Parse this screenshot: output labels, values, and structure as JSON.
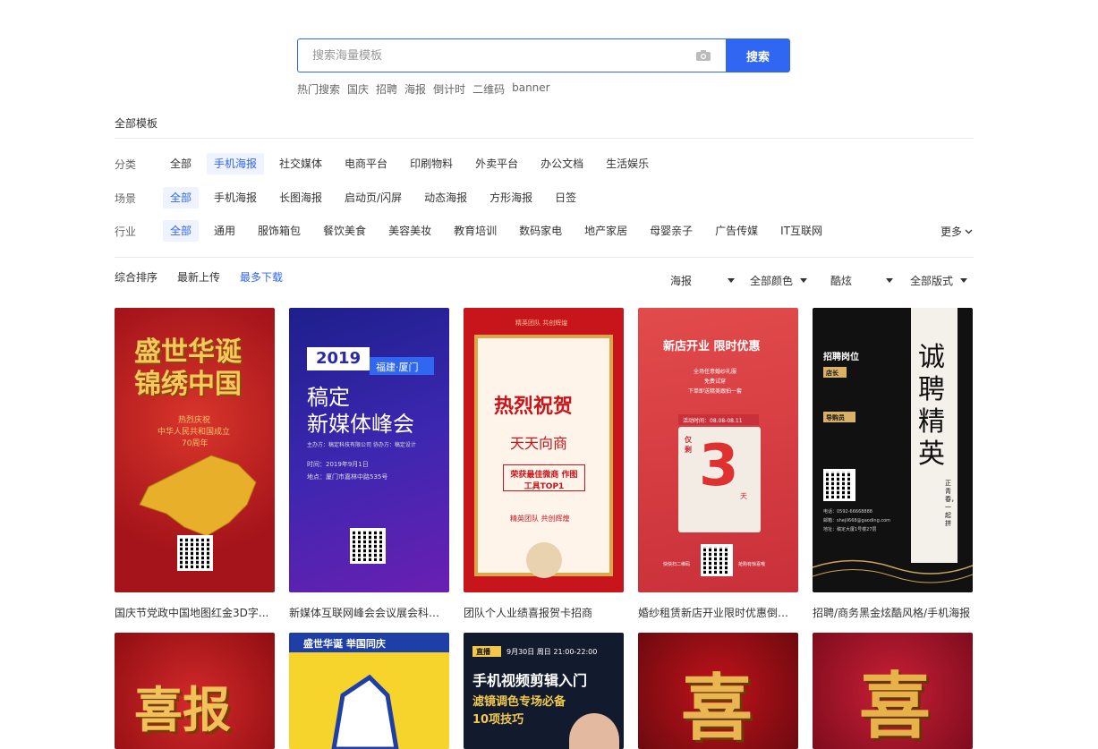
{
  "search": {
    "placeholder": "搜索海量模板",
    "button": "搜索"
  },
  "hot": {
    "label": "热门搜索",
    "items": [
      "国庆",
      "招聘",
      "海报",
      "倒计时",
      "二维码",
      "banner"
    ]
  },
  "all_templates": "全部模板",
  "category": {
    "label": "分类",
    "items": [
      "全部",
      "手机海报",
      "社交媒体",
      "电商平台",
      "印刷物料",
      "外卖平台",
      "办公文档",
      "生活娱乐"
    ],
    "active": 1
  },
  "scene": {
    "label": "场景",
    "items": [
      "全部",
      "手机海报",
      "长图海报",
      "启动页/闪屏",
      "动态海报",
      "方形海报",
      "日签"
    ],
    "active": 0
  },
  "industry": {
    "label": "行业",
    "items": [
      "全部",
      "通用",
      "服饰箱包",
      "餐饮美食",
      "美容美妆",
      "教育培训",
      "数码家电",
      "地产家居",
      "母婴亲子",
      "广告传媒",
      "IT互联网"
    ],
    "active": 0,
    "more": "更多"
  },
  "sort": {
    "items": [
      "综合排序",
      "最新上传",
      "最多下载"
    ],
    "active": 2
  },
  "filters": [
    "海报",
    "全部颜色",
    "酷炫",
    "全部版式"
  ],
  "cards": [
    {
      "caption": "国庆节党政中国地图红金3D字...",
      "title1": "盛世华诞",
      "title2": "锦绣中国",
      "sub1": "热烈庆祝",
      "sub2": "中华人民共和国成立",
      "sub3": "70周年"
    },
    {
      "caption": "新媒体互联网峰会会议展会科技...",
      "year": "2019",
      "tag": "福建·厦门",
      "title1": "稿定",
      "title2": "新媒体峰会",
      "line1": "主办方：稿定科技有限公司  协办方：稿定设计",
      "line2": "时间：2019年9月1日",
      "line3": "地点：厦门市嘉林中路535号"
    },
    {
      "caption": "团队个人业绩喜报贺卡招商",
      "top": "精英团队 共创辉煌",
      "title1": "热烈祝贺",
      "title2": "天天向商",
      "box": "荣获最佳微商 作图工具TOP1",
      "foot": "精英团队 共创辉煌"
    },
    {
      "caption": "婚纱租赁新店开业限时优惠倒计...",
      "title": "新店开业 限时优惠",
      "l1": "全场任意婚纱礼服",
      "l2": "免费试穿",
      "l3": "下单即送精美跟拍一套",
      "time": "活动时间：08.08-08.11",
      "left": "仅剩",
      "num": "3",
      "unit": "天",
      "f1": "快快扫二维码",
      "f2": "抢购有惊喜哦"
    },
    {
      "caption": "招聘/商务黑金炫酷风格/手机海报",
      "h": "招聘岗位",
      "p1": "店长",
      "p2": "导购员",
      "big": "诚聘精英",
      "side": "正青春，一起拼",
      "tel": "电话：0592-66668888",
      "mail": "邮箱：shejil668@gaoding.com",
      "addr": "地址：稿定大厦1号楼27层"
    },
    {
      "caption": "",
      "title": "喜报"
    },
    {
      "caption": "",
      "title": "盛世华诞  举国同庆"
    },
    {
      "caption": "",
      "live": "直播",
      "date": "9月30日 周日 21:00-22:00",
      "t1": "手机视频剪辑入门",
      "t2": "滤镜调色专场必备",
      "t3": "10项技巧"
    },
    {
      "caption": "",
      "title": "喜"
    },
    {
      "caption": "",
      "title": "喜"
    }
  ],
  "colors": {
    "accent": "#2f66f2"
  }
}
